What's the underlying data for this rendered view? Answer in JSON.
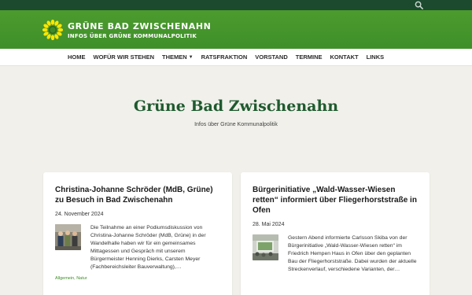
{
  "header": {
    "title": "GRÜNE BAD ZWISCHENAHN",
    "subtitle": "INFOS ÜBER GRÜNE KOMMUNALPOLITIK"
  },
  "nav": {
    "items": [
      {
        "label": "HOME"
      },
      {
        "label": "WOFÜR WIR STEHEN"
      },
      {
        "label": "THEMEN"
      },
      {
        "label": "RATSFRAKTION"
      },
      {
        "label": "VORSTAND"
      },
      {
        "label": "TERMINE"
      },
      {
        "label": "KONTAKT"
      },
      {
        "label": "LINKS"
      }
    ]
  },
  "hero": {
    "title": "Grüne Bad Zwischenahn",
    "subtitle": "Infos über Grüne Kommunalpolitik"
  },
  "posts": [
    {
      "title": "Christina-Johanne Schröder (MdB, Grüne) zu Besuch in Bad Zwischenahn",
      "date": "24. November 2024",
      "excerpt": "Die Teilnahme an einer Podiumsdiskussion von Christina-Johanne Schröder (MdB, Grüne) in der Wandelhalle haben wir für ein gemeinsames Mittagessen und Gespräch mit unserem Bürgermeister Henning Dierks, Carsten Meyer (Fachbereichsleiter Bauverwaltung),…",
      "categories": "Allgemein, Natur"
    },
    {
      "title": "Bürgerinitiative „Wald-Wasser-Wiesen retten“ informiert über Fliegerhorststraße in Ofen",
      "date": "28. Mai 2024",
      "excerpt": "Gestern Abend informierte Carlsson Skiba von der Bürgerinitiative „Wald-Wasser-Wiesen retten“ im Friedrich Hempen Haus in Ofen über den geplanten Bau der Fliegerhorststraße. Dabei wurden der aktuelle Streckenverlauf, verschiedene Varianten, der…"
    }
  ],
  "colors": {
    "topbar": "#1b4a2f",
    "header": "#3f8f2a",
    "accent": "#1e5a2f",
    "background": "#f1f0ea"
  },
  "icons": {
    "search": "search-icon",
    "logo": "sunflower-logo-icon"
  }
}
